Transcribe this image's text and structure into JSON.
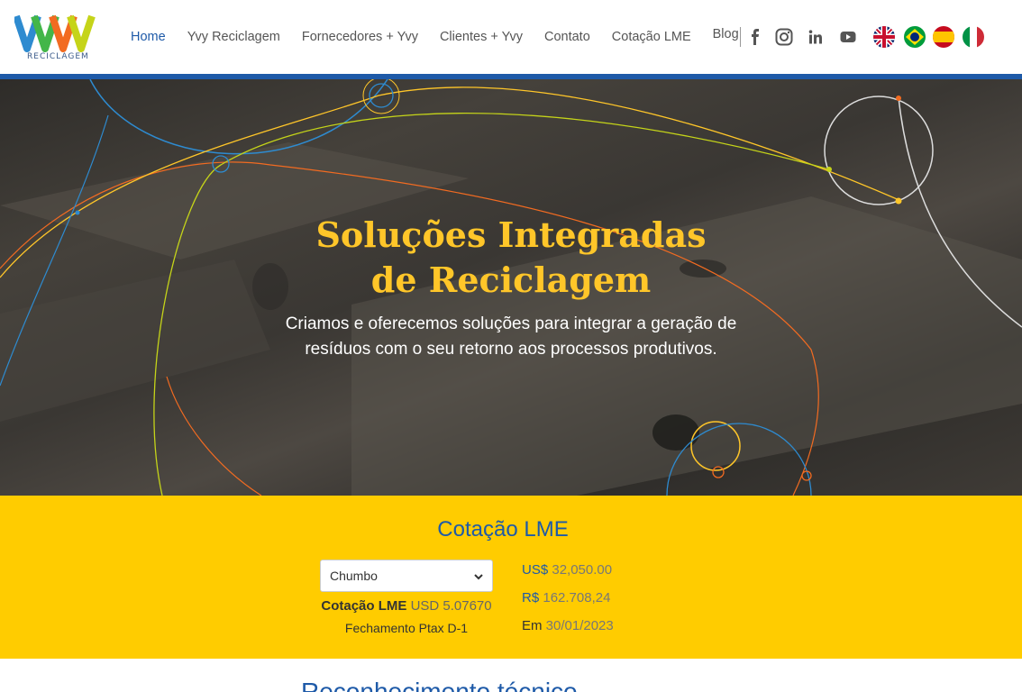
{
  "brand": {
    "logo_text": "RECICLAGEM",
    "colors": {
      "blue": "#1e5aa8",
      "yellow": "#ffcc00",
      "hero_title": "#ffc629"
    }
  },
  "nav": {
    "items": [
      {
        "label": "Home",
        "active": true
      },
      {
        "label": "Yvy Reciclagem"
      },
      {
        "label": "Fornecedores + Yvy"
      },
      {
        "label": "Clientes + Yvy"
      },
      {
        "label": "Contato"
      },
      {
        "label": "Cotação LME"
      },
      {
        "label": "Blog"
      }
    ]
  },
  "social": [
    "facebook-icon",
    "instagram-icon",
    "linkedin-icon",
    "youtube-icon"
  ],
  "languages": [
    "flag-uk",
    "flag-brazil",
    "flag-spain",
    "flag-italy"
  ],
  "hero": {
    "title_line1": "Soluções Integradas",
    "title_line2": "de Reciclagem",
    "subtitle_line1": "Criamos e oferecemos soluções para integrar a geração de",
    "subtitle_line2": "resíduos com o seu retorno aos processos produtivos."
  },
  "lme": {
    "title": "Cotação LME",
    "select_value": "Chumbo",
    "rate_label": "Cotação LME",
    "rate_value": "USD 5.07670",
    "ptax_label": "Fechamento Ptax D-1",
    "usd_currency": "US$",
    "usd_value": "32,050.00",
    "brl_currency": "R$",
    "brl_value": "162.708,24",
    "date_label": "Em",
    "date_value": "30/01/2023"
  },
  "next_section": {
    "title": "Reconhecimento técnico"
  }
}
